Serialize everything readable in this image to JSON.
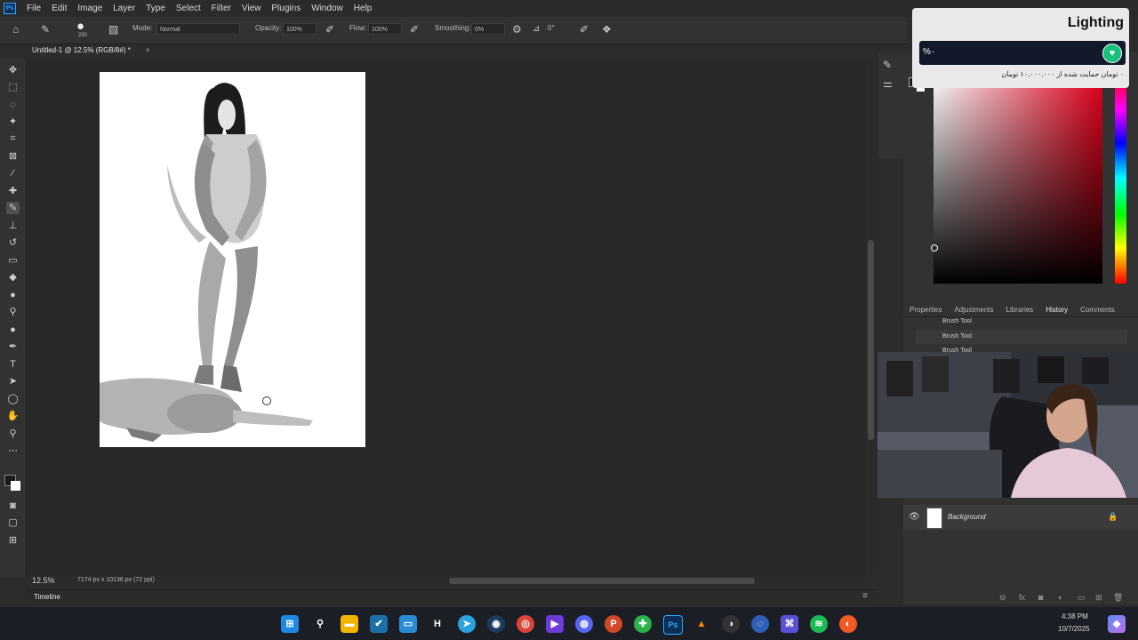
{
  "menu": {
    "app_icon": "Ps",
    "items": [
      "File",
      "Edit",
      "Image",
      "Layer",
      "Type",
      "Select",
      "Filter",
      "View",
      "Plugins",
      "Window",
      "Help"
    ]
  },
  "options": {
    "brush_size": "250",
    "mode_label": "Mode:",
    "mode_value": "Normal",
    "opacity_label": "Opacity:",
    "opacity_value": "100%",
    "flow_label": "Flow:",
    "flow_value": "100%",
    "smoothing_label": "Smoothing:",
    "smoothing_value": "0%",
    "angle_value": "0°"
  },
  "document": {
    "tab_title": "Untitled-1 @ 12.5% (RGB/8#) *",
    "zoom": "12.5%",
    "dimensions": "7174 px x 10136 px (72 ppi)"
  },
  "timeline": {
    "label": "Timeline"
  },
  "panels": {
    "tabs": [
      "Properties",
      "Adjustments",
      "Libraries",
      "History",
      "Comments"
    ],
    "active_tab": "History",
    "history": [
      "Brush Tool",
      "Brush Tool",
      "Brush Tool"
    ],
    "layer_name": "Background"
  },
  "overlay": {
    "title": "Lighting",
    "percent": "%۰",
    "note": "۰ تومان حمایت شده از ۱۰,۰۰۰,۰۰۰ تومان"
  },
  "clock": {
    "time": "4:38 PM",
    "date": "10/7/2025"
  },
  "colors": {
    "accent": "#31a8ff",
    "donation_green": "#18c17a",
    "workspace": "#282828"
  }
}
